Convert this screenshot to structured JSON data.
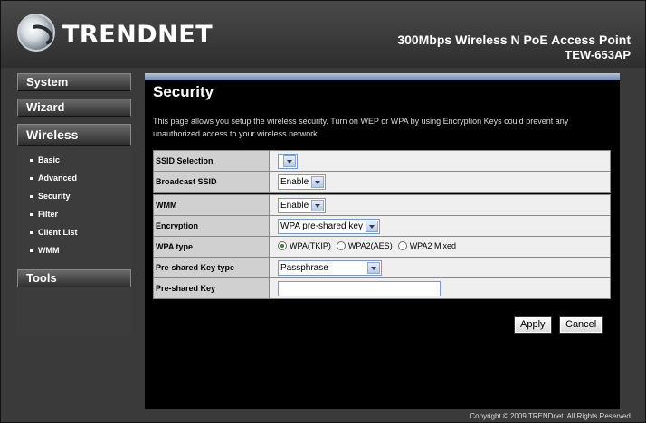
{
  "header": {
    "brand": "TRENDNET",
    "product": "300Mbps Wireless N PoE Access Point",
    "model": "TEW-653AP"
  },
  "sidebar": {
    "system": "System",
    "wizard": "Wizard",
    "wireless": "Wireless",
    "tools": "Tools",
    "wireless_items": [
      "Basic",
      "Advanced",
      "Security",
      "Filter",
      "Client List",
      "WMM"
    ]
  },
  "main": {
    "title": "Security",
    "intro": "This page allows you setup the wireless security. Turn on WEP or WPA by using Encryption Keys could prevent any unauthorized access to your wireless network."
  },
  "form": {
    "ssid_selection": {
      "label": "SSID Selection",
      "value": ""
    },
    "broadcast_ssid": {
      "label": "Broadcast SSID",
      "value": "Enable"
    },
    "wmm": {
      "label": "WMM",
      "value": "Enable"
    },
    "encryption": {
      "label": "Encryption",
      "value": "WPA pre-shared key"
    },
    "wpa_type": {
      "label": "WPA type",
      "options": [
        "WPA(TKIP)",
        "WPA2(AES)",
        "WPA2 Mixed"
      ],
      "selected": "WPA(TKIP)"
    },
    "psk_type": {
      "label": "Pre-shared Key type",
      "value": "Passphrase"
    },
    "psk": {
      "label": "Pre-shared Key",
      "value": ""
    }
  },
  "buttons": {
    "apply": "Apply",
    "cancel": "Cancel"
  },
  "footer": {
    "copyright": "Copyright © 2009 TRENDnet. All Rights Reserved."
  },
  "colors": {
    "accent_bar": "#8ea2bf",
    "radio_selected": "#2d8a2d"
  }
}
